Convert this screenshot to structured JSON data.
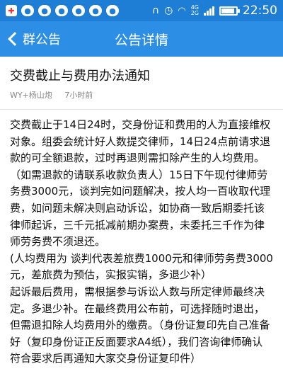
{
  "status_bar": {
    "network_top": "4G",
    "network_bottom": "2G",
    "time": "22:50",
    "battery_level": 0.9,
    "left_icons": [
      "news-icon",
      "qq-icon",
      "qq-icon",
      "qq-icon",
      "wechat-icon",
      "wechat-icon",
      "wechat-icon"
    ],
    "right_icons": [
      "headset-icon",
      "alarm-icon",
      "wifi-icon",
      "signal-icon",
      "battery-icon"
    ]
  },
  "title_bar": {
    "back_label": "群公告",
    "title": "公告详情",
    "color": "#2d8ee6"
  },
  "notice": {
    "title": "交费截止与费用办法通知",
    "author": "WY+杨山炮",
    "time": "7小时前",
    "body": "交费截止于14日24时，交身份证和费用的人为直接维权对象。组委会统计好人数提交律师，14日24点前请求退款的可全额退款，过时再退则需扣除产生的人均费用。（如需退款的请联系收款负责人）15日下午现付律师劳务费3000元，谈判完如问题解决，按人均一百收取代理费，如问题未解决则启动诉讼，如协商一致后期委托该律师起诉，三千元抵减前期办案费，未委托三千作为律师劳务费不须退还。\n(人均费用为 谈判代表差旅费1000元和律师劳务费3000元，差旅费为预估，实报实销，多退少补）\n起诉最后费用，需根据参与诉讼人数与所定律师最终决定。多退少补。在最终费用公布前，可选择随时退出，但需退扣除人均费用外的缴费。（身份证复印先自己准备好（复印身份证正反面要求A4纸），我们咨询律师确认符合要求后再通知大家交身份证复印件）"
  }
}
